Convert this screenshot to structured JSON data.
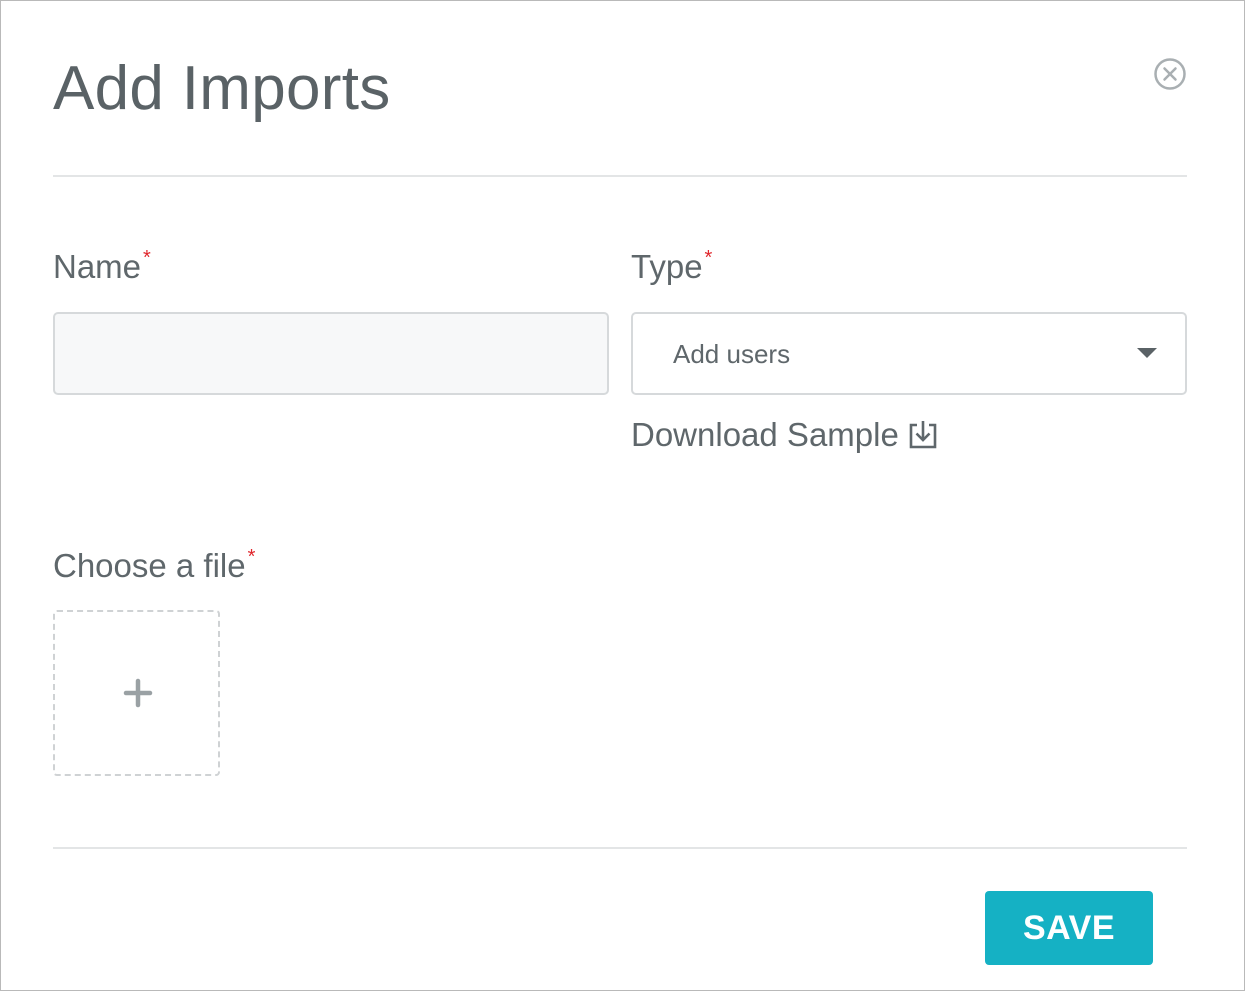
{
  "dialog": {
    "title": "Add Imports",
    "close_icon": "close-circle-icon"
  },
  "form": {
    "name": {
      "label": "Name",
      "required_mark": "*",
      "value": "",
      "placeholder": ""
    },
    "type": {
      "label": "Type",
      "required_mark": "*",
      "selected": "Add users",
      "caret_icon": "caret-down-icon"
    },
    "download_sample": {
      "label": "Download Sample",
      "icon": "download-icon"
    },
    "file": {
      "label": "Choose a file",
      "required_mark": "*",
      "upload_icon": "plus-icon"
    }
  },
  "footer": {
    "save_label": "SAVE"
  },
  "colors": {
    "accent": "#15b1c4",
    "required": "#e0262c",
    "text": "#5f676b",
    "border": "#d6d9db",
    "input_bg": "#f7f8f9"
  }
}
